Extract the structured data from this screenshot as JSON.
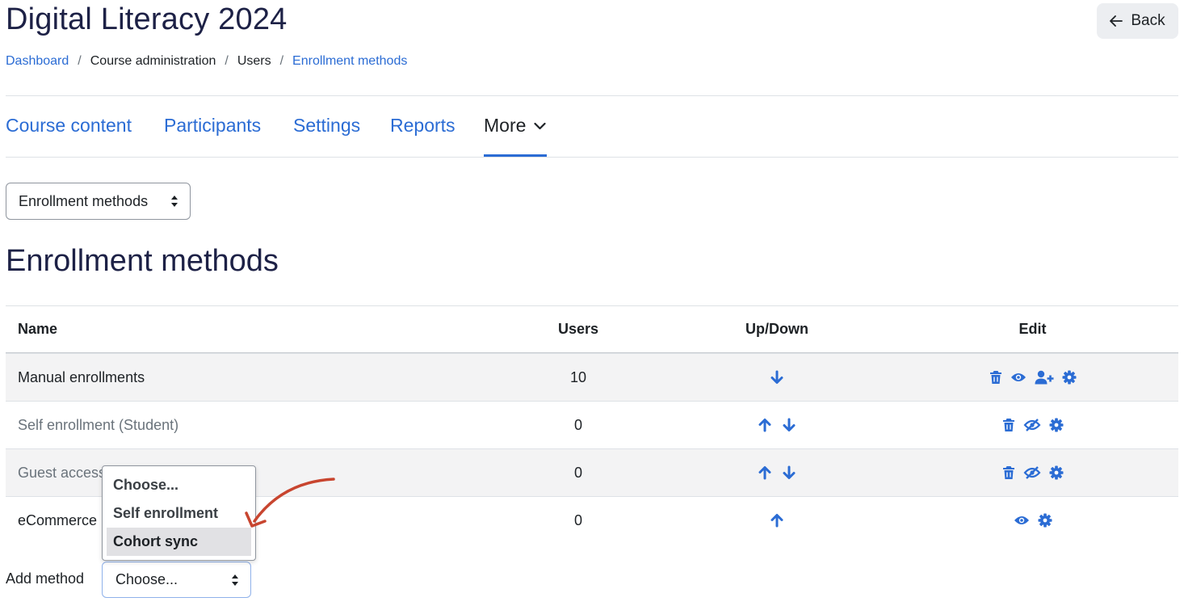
{
  "header": {
    "title": "Digital Literacy 2024",
    "back_label": "Back"
  },
  "breadcrumb": [
    {
      "label": "Dashboard",
      "link": true
    },
    {
      "label": "Course administration",
      "link": false
    },
    {
      "label": "Users",
      "link": false
    },
    {
      "label": "Enrollment methods",
      "link": true
    }
  ],
  "nav": {
    "tabs": [
      {
        "label": "Course content"
      },
      {
        "label": "Participants"
      },
      {
        "label": "Settings"
      },
      {
        "label": "Reports"
      },
      {
        "label": "More",
        "active": true
      }
    ]
  },
  "page_select": {
    "value": "Enrollment methods"
  },
  "main": {
    "heading": "Enrollment methods"
  },
  "table": {
    "columns": [
      "Name",
      "Users",
      "Up/Down",
      "Edit"
    ],
    "rows": [
      {
        "name": "Manual enrollments",
        "users": "10",
        "updown": [
          "down"
        ],
        "edit": [
          "trash-icon",
          "eye-icon",
          "user-plus-icon",
          "gear-icon"
        ],
        "enabled": true
      },
      {
        "name": "Self enrollment (Student)",
        "users": "0",
        "updown": [
          "up",
          "down"
        ],
        "edit": [
          "trash-icon",
          "eye-slash-icon",
          "gear-icon"
        ],
        "enabled": false
      },
      {
        "name": "Guest access",
        "users": "0",
        "updown": [
          "up",
          "down"
        ],
        "edit": [
          "trash-icon",
          "eye-slash-icon",
          "gear-icon"
        ],
        "enabled": false
      },
      {
        "name": "eCommerce",
        "users": "0",
        "updown": [
          "up"
        ],
        "edit": [
          "eye-icon",
          "gear-icon"
        ],
        "enabled": true
      }
    ]
  },
  "add_method": {
    "label": "Add method",
    "value": "Choose...",
    "options": [
      "Choose...",
      "Self enrollment",
      "Cohort sync"
    ],
    "highlighted": "Cohort sync"
  },
  "colors": {
    "accent": "#2b6cd4",
    "heading": "#1d2146",
    "annotation_arrow": "#c8452f"
  }
}
